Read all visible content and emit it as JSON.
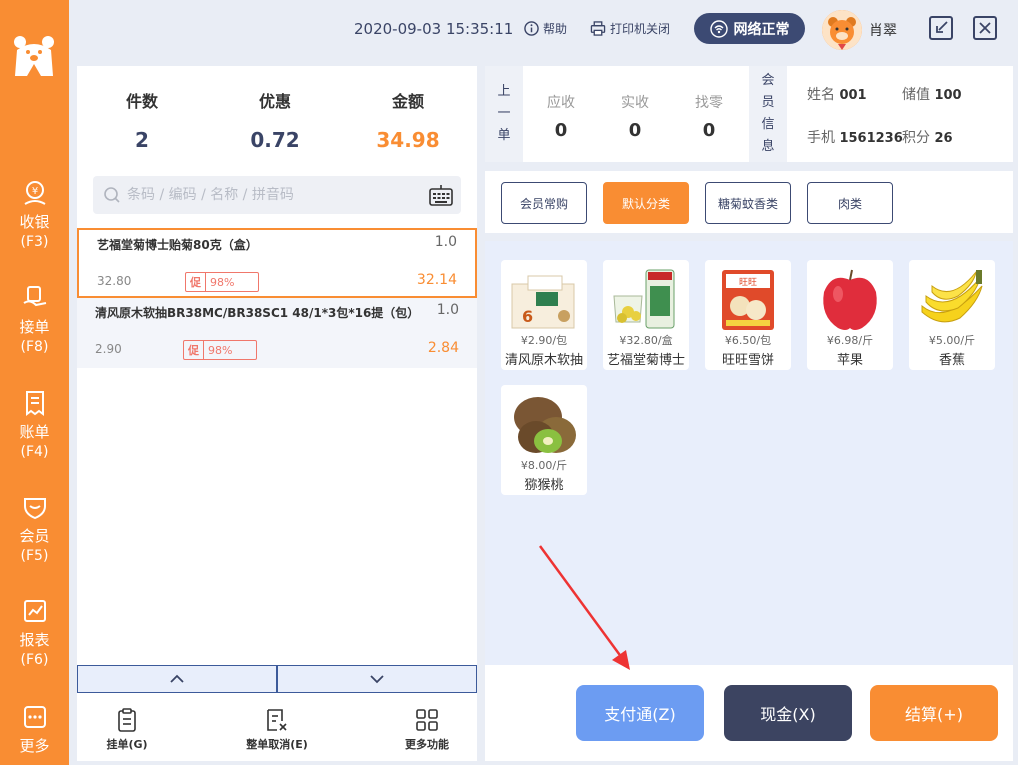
{
  "topbar": {
    "datetime": "2020-09-03 15:35:11",
    "help_label": "帮助",
    "printer_label": "打印机关闭",
    "network_label": "网络正常",
    "user_name": "肖翠"
  },
  "sidebar": {
    "items": [
      {
        "label": "收银",
        "hotkey": "(F3)",
        "icon": "cashier-icon"
      },
      {
        "label": "接单",
        "hotkey": "(F8)",
        "icon": "receive-order-icon"
      },
      {
        "label": "账单",
        "hotkey": "(F4)",
        "icon": "bill-icon"
      },
      {
        "label": "会员",
        "hotkey": "(F5)",
        "icon": "member-icon"
      },
      {
        "label": "报表",
        "hotkey": "(F6)",
        "icon": "report-icon"
      },
      {
        "label": "更多",
        "hotkey": "",
        "icon": "more-icon"
      }
    ]
  },
  "summary": {
    "count_label": "件数",
    "count_value": "2",
    "discount_label": "优惠",
    "discount_value": "0.72",
    "amount_label": "金额",
    "amount_value": "34.98"
  },
  "search": {
    "placeholder": "条码 / 编码 / 名称 / 拼音码"
  },
  "cart_items": [
    {
      "name": "艺福堂菊博士贻菊80克（盒）",
      "qty": "1.0",
      "price": "32.80",
      "promo_tag": "促",
      "promo_value": "98%",
      "subtotal": "32.14"
    },
    {
      "name": "清风原木软抽BR38MC/BR38SC1 48/1*3包*16提（包）",
      "qty": "1.0",
      "price": "2.90",
      "promo_tag": "促",
      "promo_value": "98%",
      "subtotal": "2.84"
    }
  ],
  "cart_actions": [
    {
      "label": "挂单(G)"
    },
    {
      "label": "整单取消(E)"
    },
    {
      "label": "更多功能"
    }
  ],
  "member_panel": {
    "prev_label": [
      "上",
      "一",
      "单"
    ],
    "receivable_label": "应收",
    "receivable_value": "0",
    "received_label": "实收",
    "received_value": "0",
    "change_label": "找零",
    "change_value": "0",
    "info_tag": [
      "会",
      "员",
      "信",
      "息"
    ],
    "name_label": "姓名",
    "name_value": "001",
    "balance_label": "储值",
    "balance_value": "100",
    "phone_label": "手机",
    "phone_value": "1561236",
    "points_label": "积分",
    "points_value": "26"
  },
  "categories": [
    {
      "label": "会员常购",
      "active": false
    },
    {
      "label": "默认分类",
      "active": true
    },
    {
      "label": "糖菊蚊香类",
      "active": false
    },
    {
      "label": "肉类",
      "active": false
    }
  ],
  "products": [
    {
      "price": "¥2.90/包",
      "name": "清风原木软抽",
      "icon": "tissue-box-icon"
    },
    {
      "price": "¥32.80/盒",
      "name": "艺福堂菊博士",
      "icon": "chrysanthemum-tea-icon"
    },
    {
      "price": "¥6.50/包",
      "name": "旺旺雪饼",
      "icon": "rice-cracker-icon"
    },
    {
      "price": "¥6.98/斤",
      "name": "苹果",
      "icon": "apple-icon"
    },
    {
      "price": "¥5.00/斤",
      "name": "香蕉",
      "icon": "banana-icon"
    },
    {
      "price": "¥8.00/斤",
      "name": "猕猴桃",
      "icon": "kiwi-icon"
    }
  ],
  "pay": {
    "alipay_label": "支付通(Z)",
    "cash_label": "现金(X)",
    "checkout_label": "结算(+)"
  },
  "colors": {
    "accent": "#f98d33",
    "navy": "#3c4a73",
    "pay_blue": "#6c9cf2"
  }
}
